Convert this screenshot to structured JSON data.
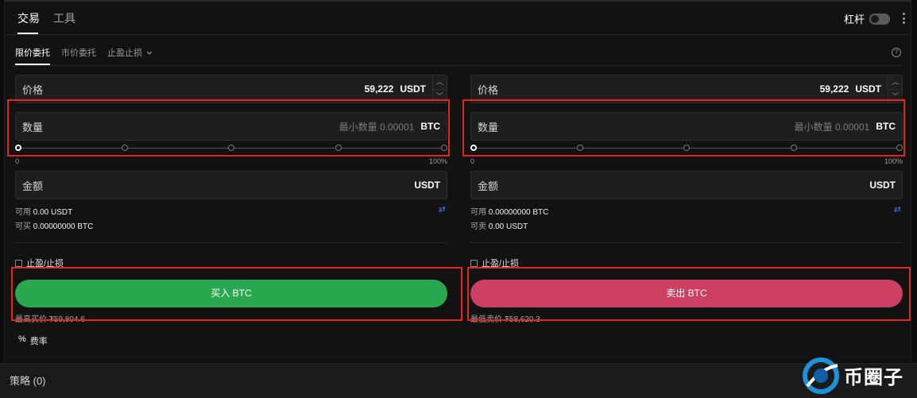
{
  "tabs": {
    "trade": "交易",
    "tools": "工具"
  },
  "leverage": {
    "label": "杠杆",
    "enabled": false
  },
  "order_types": {
    "limit": "限价委托",
    "market": "市价委托",
    "tpsl": "止盈止损"
  },
  "buy": {
    "price_label": "价格",
    "price_value": "59,222",
    "price_unit": "USDT",
    "qty_label": "数量",
    "qty_placeholder": "最小数量 0.00001",
    "qty_unit": "BTC",
    "slider_min": "0",
    "slider_max": "100%",
    "amount_label": "金额",
    "amount_unit": "USDT",
    "avail_label": "可用",
    "avail_value": "0.00 USDT",
    "can_label": "可买",
    "can_value": "0.00000000 BTC",
    "tpsl_label": "止盈/止损",
    "action": "买入 BTC",
    "best_label": "最高买价",
    "best_value": "₮59,804.6"
  },
  "sell": {
    "price_label": "价格",
    "price_value": "59,222",
    "price_unit": "USDT",
    "qty_label": "数量",
    "qty_placeholder": "最小数量 0.00001",
    "qty_unit": "BTC",
    "slider_min": "0",
    "slider_max": "100%",
    "amount_label": "金额",
    "amount_unit": "USDT",
    "avail_label": "可用",
    "avail_value": "0.00000000 BTC",
    "can_label": "可卖",
    "can_value": "0.00 USDT",
    "tpsl_label": "止盈/止损",
    "action": "卖出 BTC",
    "best_label": "最低卖价",
    "best_value": "₮58,620.3"
  },
  "fee": {
    "icon": "%",
    "label": "费率"
  },
  "bottom": {
    "strategy": "策略 (0)"
  },
  "watermark": {
    "text": "币圈子"
  },
  "colors": {
    "buy": "#2aa84f",
    "sell": "#cc3f63",
    "highlight": "#e1261c",
    "swap": "#3d7bff"
  },
  "icons": [
    "more-vertical-icon",
    "help-icon",
    "chevron-down-icon",
    "stepper-up-icon",
    "stepper-down-icon",
    "swap-icon",
    "checkbox-icon",
    "percent-icon"
  ]
}
